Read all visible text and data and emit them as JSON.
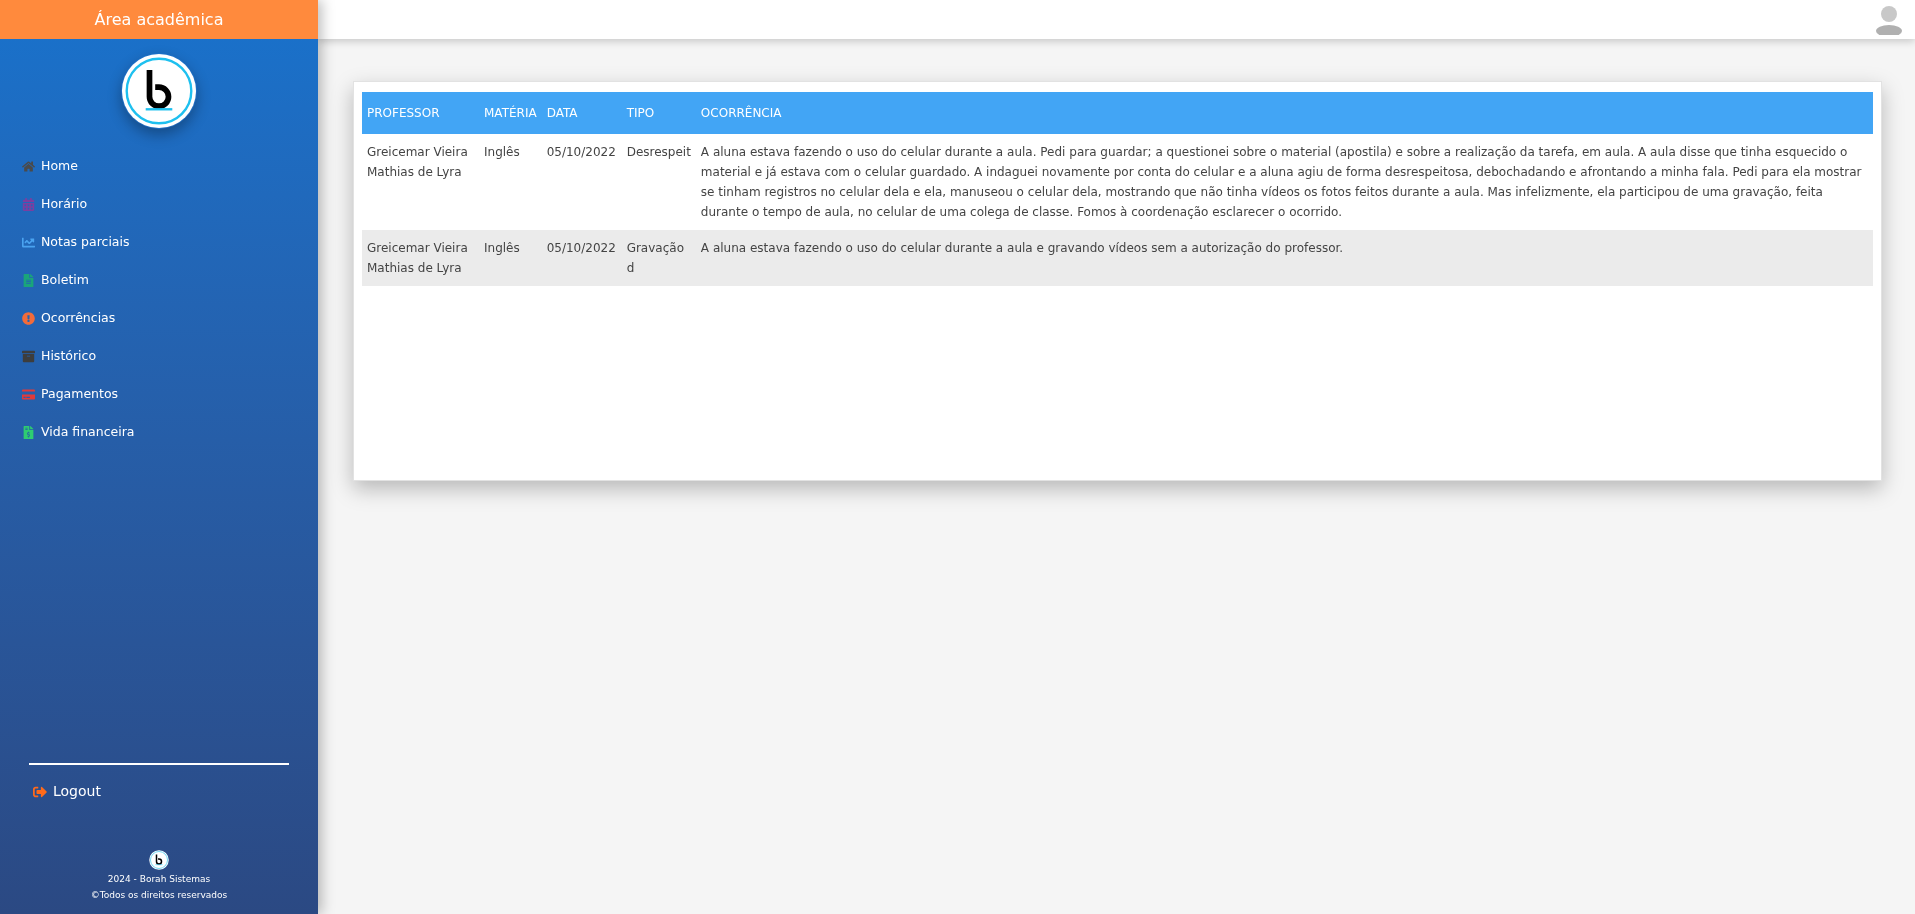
{
  "sidebar": {
    "title": "Área acadêmica",
    "items": [
      {
        "label": "Home"
      },
      {
        "label": "Horário"
      },
      {
        "label": "Notas parciais"
      },
      {
        "label": "Boletim"
      },
      {
        "label": "Ocorrências"
      },
      {
        "label": "Histórico"
      },
      {
        "label": "Pagamentos"
      },
      {
        "label": "Vida financeira"
      }
    ],
    "logout": "Logout",
    "footer": [
      "2024 - Borah Sistemas",
      "©Todos os direitos reservados"
    ]
  },
  "table": {
    "columns": [
      "PROFESSOR",
      "MATÉRIA",
      "DATA",
      "TIPO",
      "OCORRÊNCIA"
    ],
    "rows": [
      [
        "Greicemar Vieira Mathias de Lyra",
        "Inglês",
        "05/10/2022",
        "Desrespeit",
        "A aluna estava fazendo o uso do celular durante a aula. Pedi para guardar; a questionei sobre o material (apostila) e sobre a realização da tarefa, em aula. A aula disse que tinha esquecido o material e já estava com o celular guardado. A indaguei novamente por conta do celular e a aluna agiu de forma desrespeitosa, debochadando e afrontando a minha fala. Pedi para ela mostrar se tinham registros no celular dela e ela, manuseou o celular dela, mostrando que não tinha vídeos os fotos feitos durante a aula. Mas infelizmente, ela participou de uma gravação, feita durante o tempo de aula, no celular de uma colega de classe. Fomos à coordenação esclarecer o ocorrido."
      ],
      [
        "Greicemar Vieira Mathias de Lyra",
        "Inglês",
        "05/10/2022",
        "Gravação d",
        "A aluna estava fazendo o uso do celular durante a aula e gravando vídeos sem a autorização do professor."
      ]
    ]
  }
}
